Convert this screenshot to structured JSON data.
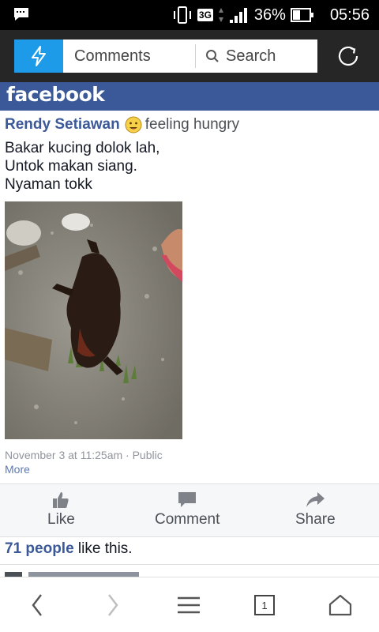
{
  "status_bar": {
    "network": "3G",
    "battery": "36%",
    "time": "05:56"
  },
  "browser": {
    "tab_title": "Comments",
    "search_label": "Search",
    "accent_color": "#1e9be8"
  },
  "facebook": {
    "logo": "facebook",
    "brand_color": "#3b5998"
  },
  "post": {
    "author": "Rendy Setiawan",
    "feeling": "feeling hungry",
    "text_lines": [
      "Bakar kucing dolok lah,",
      "Untok makan siang.",
      "Nyaman tokk"
    ],
    "timestamp": "November 3 at 11:25am · Public",
    "more_label": "More"
  },
  "actions": {
    "like": "Like",
    "comment": "Comment",
    "share": "Share"
  },
  "likes": {
    "count_text": "71 people",
    "suffix": " like this."
  },
  "bottom_nav": {
    "tab_count": "1"
  }
}
